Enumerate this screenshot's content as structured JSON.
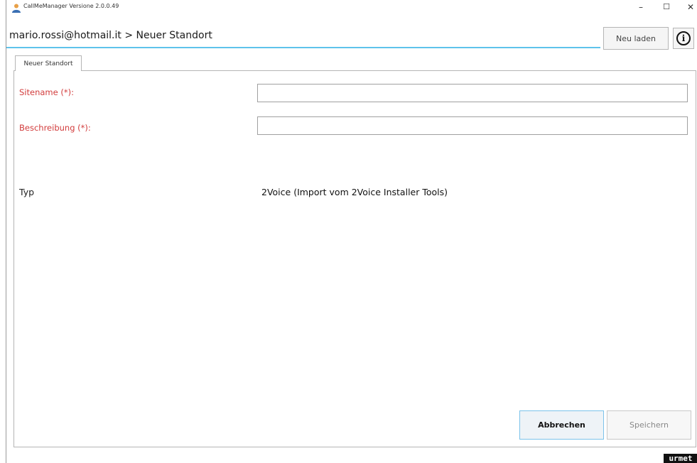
{
  "window": {
    "title": "CallMeManager Versione 2.0.0.49",
    "controls": {
      "minimize": "–",
      "maximize": "☐",
      "close": "✕"
    }
  },
  "header": {
    "breadcrumb": "mario.rossi@hotmail.it > Neuer Standort",
    "reload_label": "Neu laden",
    "info_label": "i"
  },
  "tabs": [
    {
      "label": "Neuer Standort"
    }
  ],
  "form": {
    "sitename": {
      "label": "Sitename (*):",
      "value": "",
      "placeholder": ""
    },
    "description": {
      "label": "Beschreibung (*):",
      "value": "",
      "placeholder": ""
    },
    "type": {
      "label": "Typ",
      "value": "2Voice (Import vom 2Voice Installer Tools)"
    }
  },
  "footer": {
    "cancel_label": "Abbrechen",
    "save_label": "Speichern"
  },
  "brand": {
    "logo_text": "urmet"
  },
  "colors": {
    "accent": "#5ec3eb",
    "required_label": "#d23c3c"
  }
}
